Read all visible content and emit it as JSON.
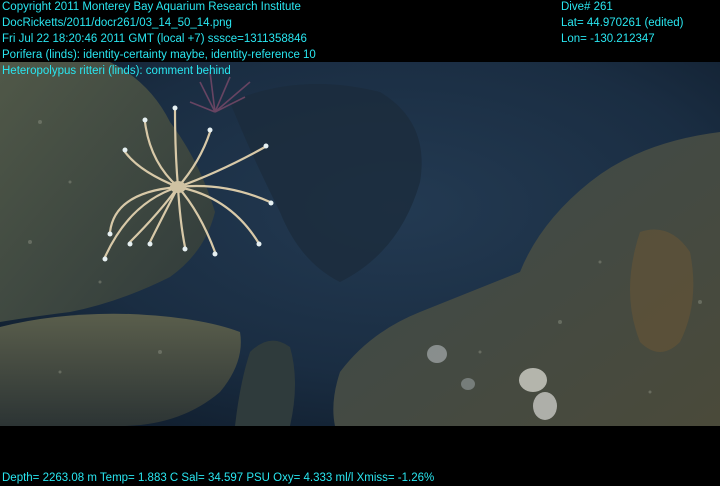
{
  "overlay": {
    "left_lines": [
      "Copyright 2011 Monterey Bay Aquarium Research Institute",
      "DocRicketts/2011/docr261/03_14_50_14.png",
      "Fri Jul 22 18:20:46 2011 GMT (local +7)  sssce=1311358846",
      "Porifera (linds): identity-certainty maybe, identity-reference 10",
      "Heteropolypus ritteri (linds): comment behind"
    ],
    "right_lines": [
      "Dive# 261",
      "Lat= 44.970261 (edited)",
      "Lon= -130.212347"
    ],
    "bottom_line": "Depth= 2263.08 m  Temp= 1.883 C  Sal= 34.597 PSU  Oxy= 4.333 ml/l  Xmiss= -1.26%"
  },
  "colors": {
    "overlay_text": "#29e6f0",
    "water": "#1d3348",
    "rock": "#4a5548"
  }
}
